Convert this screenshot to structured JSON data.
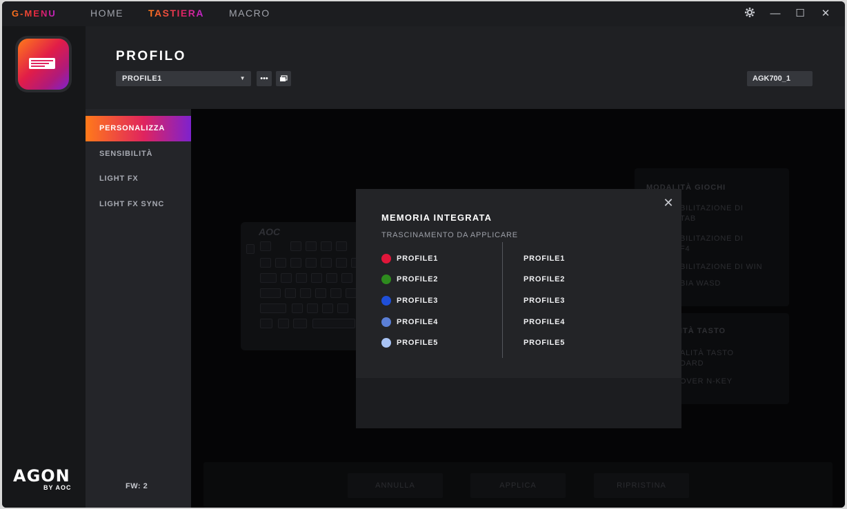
{
  "app": {
    "brand": "G-MENU"
  },
  "topnav": {
    "home": "HOME",
    "tastiera": "TASTIERA",
    "macro": "MACRO"
  },
  "window_controls": {
    "settings_icon": "gear-icon",
    "minimize": "—",
    "maximize": "☐",
    "close": "✕"
  },
  "header": {
    "title": "PROFILO",
    "profile_selected": "PROFILE1",
    "more_label": "•••",
    "device": "AGK700_1"
  },
  "subnav": {
    "items": [
      {
        "label": "PERSONALIZZA",
        "active": true
      },
      {
        "label": "SENSIBILITÀ",
        "active": false
      },
      {
        "label": "LIGHT FX",
        "active": false
      },
      {
        "label": "LIGHT FX SYNC",
        "active": false
      }
    ],
    "fw": "FW: 2"
  },
  "brand_logo": {
    "agon": "AGON",
    "by": "BY AOC"
  },
  "keyboard": {
    "logo": "AOC"
  },
  "background_panels": {
    "game_mode": {
      "title": "MODALITÀ GIOCHI",
      "lines": [
        "BILITAZIONE DI",
        "TAB",
        "BILITAZIONE DI",
        "F4",
        "BILITAZIONE DI WIN",
        "BIA WASD"
      ]
    },
    "key_mode": {
      "title": "ITÀ TASTO",
      "lines": [
        "ALITÀ TASTO",
        "DARD",
        "OVER N-KEY"
      ]
    }
  },
  "bottom_buttons": {
    "annulla": "ANNULLA",
    "applica": "APPLICA",
    "ripristina": "RIPRISTINA"
  },
  "modal": {
    "title": "MEMORIA INTEGRATA",
    "subtitle": "TRASCINAMENTO DA APPLICARE",
    "left_profiles": [
      {
        "label": "PROFILE1",
        "color": "#e0163a"
      },
      {
        "label": "PROFILE2",
        "color": "#2e8b1e"
      },
      {
        "label": "PROFILE3",
        "color": "#1f4fd8"
      },
      {
        "label": "PROFILE4",
        "color": "#5b7fd6"
      },
      {
        "label": "PROFILE5",
        "color": "#a9c4f5"
      }
    ],
    "right_profiles": [
      "PROFILE1",
      "PROFILE2",
      "PROFILE3",
      "PROFILE4",
      "PROFILE5"
    ]
  }
}
